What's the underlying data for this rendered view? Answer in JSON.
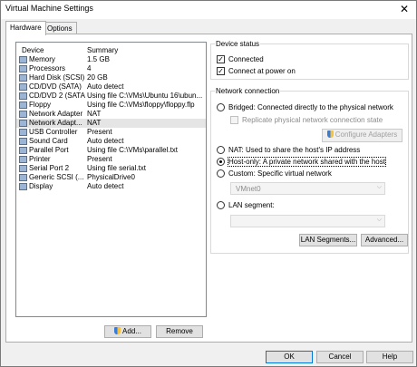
{
  "window": {
    "title": "Virtual Machine Settings"
  },
  "tabs": [
    {
      "label": "Hardware",
      "active": true
    },
    {
      "label": "Options",
      "active": false
    }
  ],
  "devices": {
    "col_device": "Device",
    "col_summary": "Summary",
    "rows": [
      {
        "name": "Memory",
        "summary": "1.5 GB",
        "icon": "memory-icon"
      },
      {
        "name": "Processors",
        "summary": "4",
        "icon": "processor-icon"
      },
      {
        "name": "Hard Disk (SCSI)",
        "summary": "20 GB",
        "icon": "hard-disk-icon"
      },
      {
        "name": "CD/DVD (SATA)",
        "summary": "Auto detect",
        "icon": "cd-dvd-icon"
      },
      {
        "name": "CD/DVD 2 (SATA)",
        "summary": "Using file C:\\VMs\\Ubuntu 16\\ubun...",
        "icon": "cd-dvd-icon"
      },
      {
        "name": "Floppy",
        "summary": "Using file C:\\VMs\\floppy\\floppy.flp",
        "icon": "floppy-icon"
      },
      {
        "name": "Network Adapter",
        "summary": "NAT",
        "icon": "network-adapter-icon"
      },
      {
        "name": "Network Adapt...",
        "summary": "NAT",
        "icon": "network-adapter-icon",
        "selected": true
      },
      {
        "name": "USB Controller",
        "summary": "Present",
        "icon": "usb-icon"
      },
      {
        "name": "Sound Card",
        "summary": "Auto detect",
        "icon": "sound-card-icon"
      },
      {
        "name": "Parallel Port",
        "summary": "Using file C:\\VMs\\parallel.txt",
        "icon": "parallel-port-icon"
      },
      {
        "name": "Printer",
        "summary": "Present",
        "icon": "printer-icon"
      },
      {
        "name": "Serial Port 2",
        "summary": "Using file serial.txt",
        "icon": "serial-port-icon"
      },
      {
        "name": "Generic SCSI (...",
        "summary": "PhysicalDrive0",
        "icon": "scsi-icon"
      },
      {
        "name": "Display",
        "summary": "Auto detect",
        "icon": "display-icon"
      }
    ],
    "add_label": "Add...",
    "remove_label": "Remove"
  },
  "device_status": {
    "legend": "Device status",
    "connected_label": "Connected",
    "connected_checked": true,
    "connect_at_power_on_label": "Connect at power on",
    "connect_at_power_on_checked": true
  },
  "network_connection": {
    "legend": "Network connection",
    "bridged_label": "Bridged: Connected directly to the physical network",
    "replicate_label": "Replicate physical network connection state",
    "configure_adapters_label": "Configure Adapters",
    "nat_label": "NAT: Used to share the host's IP address",
    "host_only_label": "Host-only: A private network shared with the host",
    "custom_label": "Custom: Specific virtual network",
    "custom_value": "VMnet0",
    "lan_segment_label": "LAN segment:",
    "lan_segment_value": "",
    "selected": "host-only",
    "lan_segments_button": "LAN Segments...",
    "advanced_button": "Advanced..."
  },
  "footer": {
    "ok_label": "OK",
    "cancel_label": "Cancel",
    "help_label": "Help"
  },
  "colors": {
    "selection": "#e5e5e5",
    "focus_border": "#0078d7",
    "panel_background": "#ffffff",
    "dialog_background": "#f0f0f0"
  }
}
